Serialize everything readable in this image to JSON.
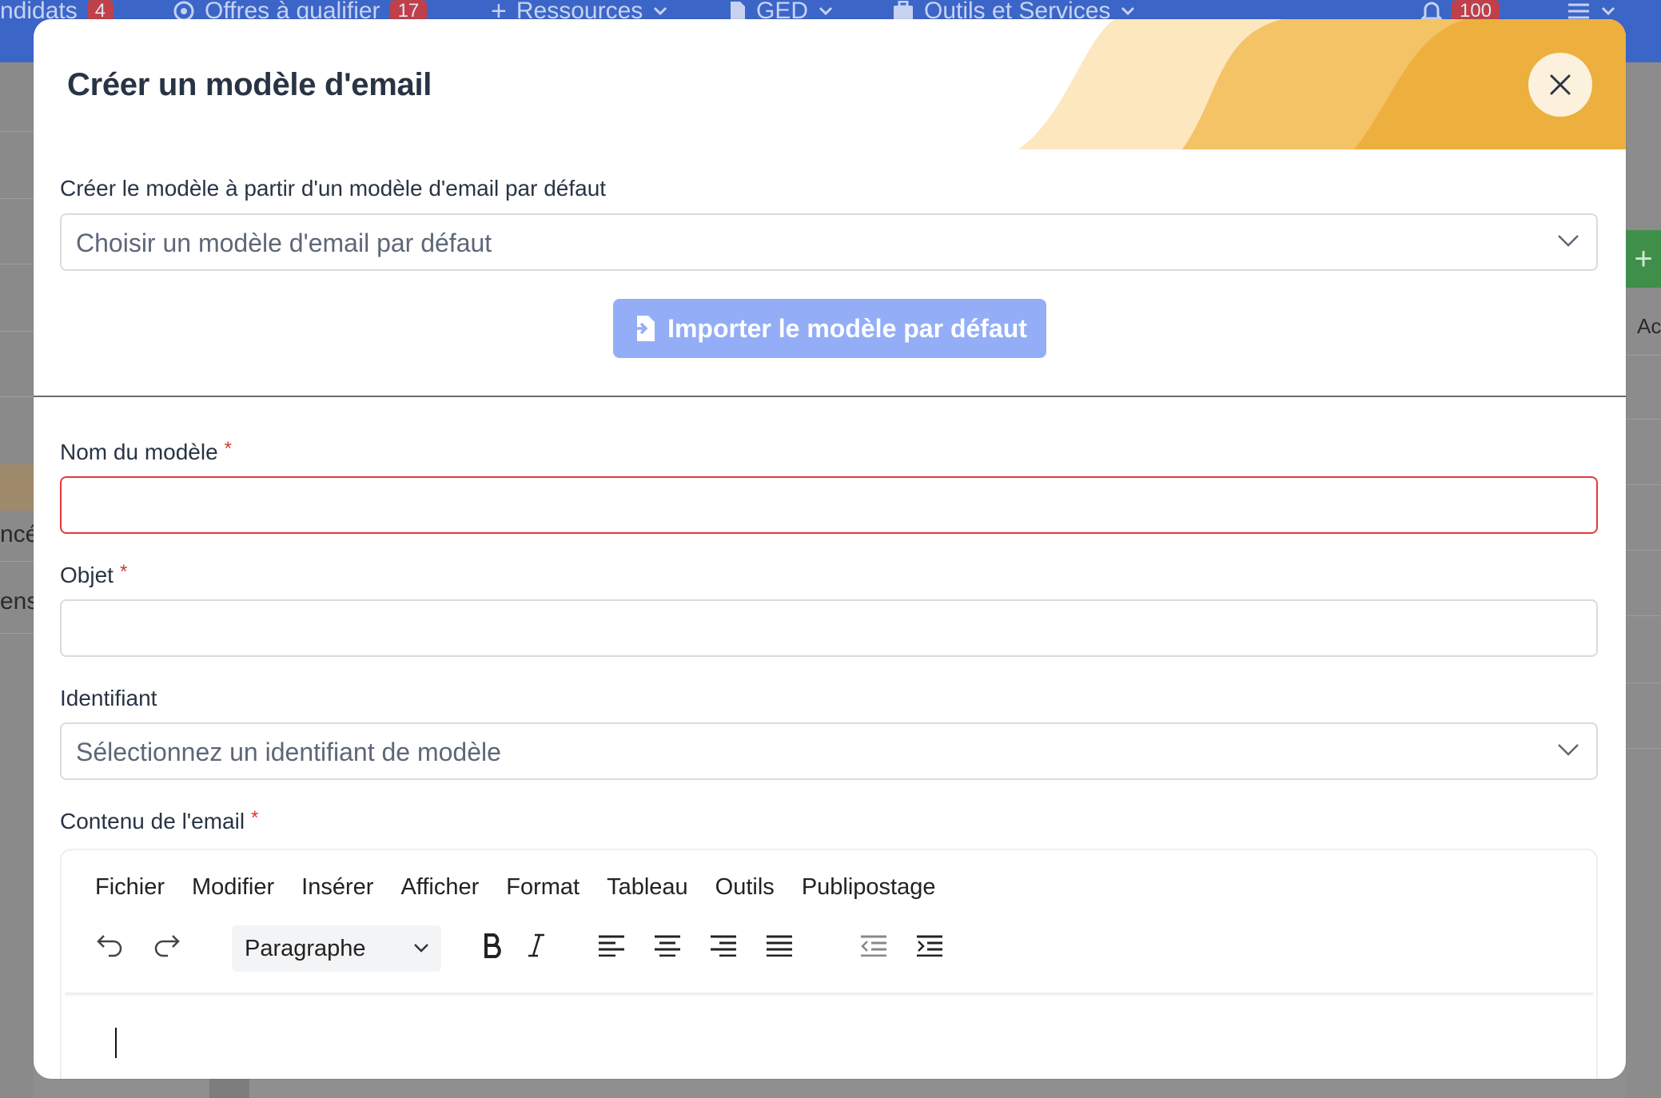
{
  "topnav": {
    "items": [
      {
        "label": "ndidats",
        "badge": "4"
      },
      {
        "label": "Offres à qualifier",
        "badge": "17"
      },
      {
        "label": "Ressources"
      },
      {
        "label": "GED"
      },
      {
        "label": "Outils et Services"
      },
      {
        "badge": "100"
      }
    ]
  },
  "background": {
    "left_text_1": "ncé",
    "left_text_2": "ens",
    "right_text": "Ac"
  },
  "modal": {
    "title": "Créer un modèle d'email",
    "default_template": {
      "label": "Créer le modèle à partir d'un modèle d'email par défaut",
      "placeholder": "Choisir un modèle d'email par défaut"
    },
    "import_button": "Importer le modèle par défaut",
    "name_field": {
      "label": "Nom du modèle",
      "value": ""
    },
    "subject_field": {
      "label": "Objet",
      "value": ""
    },
    "identifier": {
      "label": "Identifiant",
      "placeholder": "Sélectionnez un identifiant de modèle"
    },
    "content": {
      "label": "Contenu de l'email",
      "menu": [
        "Fichier",
        "Modifier",
        "Insérer",
        "Afficher",
        "Format",
        "Tableau",
        "Outils",
        "Publipostage"
      ],
      "block_format": "Paragraphe"
    },
    "required_mark": "*"
  },
  "colors": {
    "accent_nav": "#3c65c8",
    "import_button": "#93aef7",
    "error_border": "#e03a3a",
    "required": "#d73a32",
    "deco_yellow": "#edb03e"
  }
}
